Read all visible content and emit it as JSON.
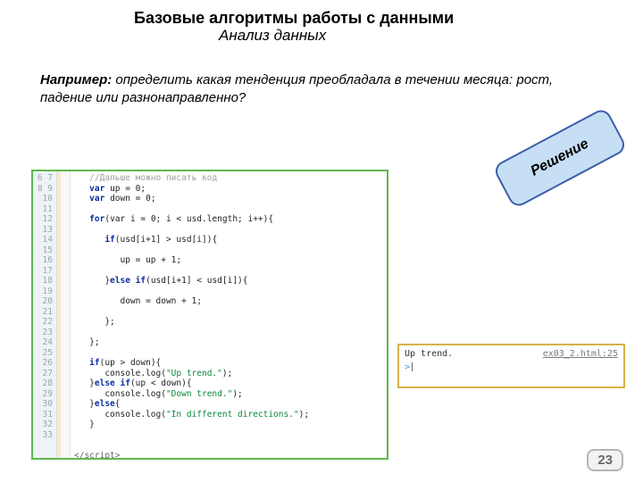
{
  "title": "Базовые алгоритмы работы с данными",
  "subtitle": "Анализ данных",
  "example_label": "Например:",
  "example_text": " определить какая тенденция преобладала в течении месяца: рост, падение или разнонаправленно?",
  "solution_label": "Решение",
  "page_number": "23",
  "code": {
    "line_start": 6,
    "lines": [
      {
        "indent": 1,
        "t": "comment",
        "text": "//Дальше можно писать код"
      },
      {
        "indent": 1,
        "t": "decl",
        "kw": "var",
        "rest": " up = 0;"
      },
      {
        "indent": 1,
        "t": "decl",
        "kw": "var",
        "rest": " down = 0;"
      },
      {
        "indent": 0,
        "t": "blank",
        "text": ""
      },
      {
        "indent": 1,
        "t": "for",
        "kw": "for",
        "rest": "(var i = 0; i < usd.length; i++){"
      },
      {
        "indent": 0,
        "t": "blank",
        "text": ""
      },
      {
        "indent": 2,
        "t": "if",
        "kw": "if",
        "rest": "(usd[i+1] > usd[i]){"
      },
      {
        "indent": 0,
        "t": "blank",
        "text": ""
      },
      {
        "indent": 3,
        "t": "plain",
        "text": "up = up + 1;"
      },
      {
        "indent": 0,
        "t": "blank",
        "text": ""
      },
      {
        "indent": 2,
        "t": "elseif",
        "pre": "}",
        "kw": "else if",
        "rest": "(usd[i+1] < usd[i]){"
      },
      {
        "indent": 0,
        "t": "blank",
        "text": ""
      },
      {
        "indent": 3,
        "t": "plain",
        "text": "down = down + 1;"
      },
      {
        "indent": 0,
        "t": "blank",
        "text": ""
      },
      {
        "indent": 2,
        "t": "plain",
        "text": "};"
      },
      {
        "indent": 0,
        "t": "blank",
        "text": ""
      },
      {
        "indent": 1,
        "t": "plain",
        "text": "};"
      },
      {
        "indent": 0,
        "t": "blank",
        "text": ""
      },
      {
        "indent": 1,
        "t": "if",
        "kw": "if",
        "rest": "(up > down){"
      },
      {
        "indent": 2,
        "t": "log",
        "pre": "console.log(",
        "str": "\"Up trend.\"",
        "post": ");"
      },
      {
        "indent": 1,
        "t": "elseif",
        "pre": "}",
        "kw": "else if",
        "rest": "(up < down){"
      },
      {
        "indent": 2,
        "t": "log",
        "pre": "console.log(",
        "str": "\"Down trend.\"",
        "post": ");"
      },
      {
        "indent": 1,
        "t": "else",
        "pre": "}",
        "kw": "else",
        "rest": "{"
      },
      {
        "indent": 2,
        "t": "log",
        "pre": "console.log(",
        "str": "\"In different directions.\"",
        "post": ");"
      },
      {
        "indent": 1,
        "t": "plain",
        "text": "}"
      },
      {
        "indent": 0,
        "t": "blank",
        "text": ""
      },
      {
        "indent": 0,
        "t": "blank",
        "text": ""
      },
      {
        "indent": 0,
        "t": "tag",
        "text": "</script>"
      }
    ]
  },
  "console": {
    "output": "Up trend.",
    "source": "ex03_2.html:25",
    "prompt": ">"
  }
}
